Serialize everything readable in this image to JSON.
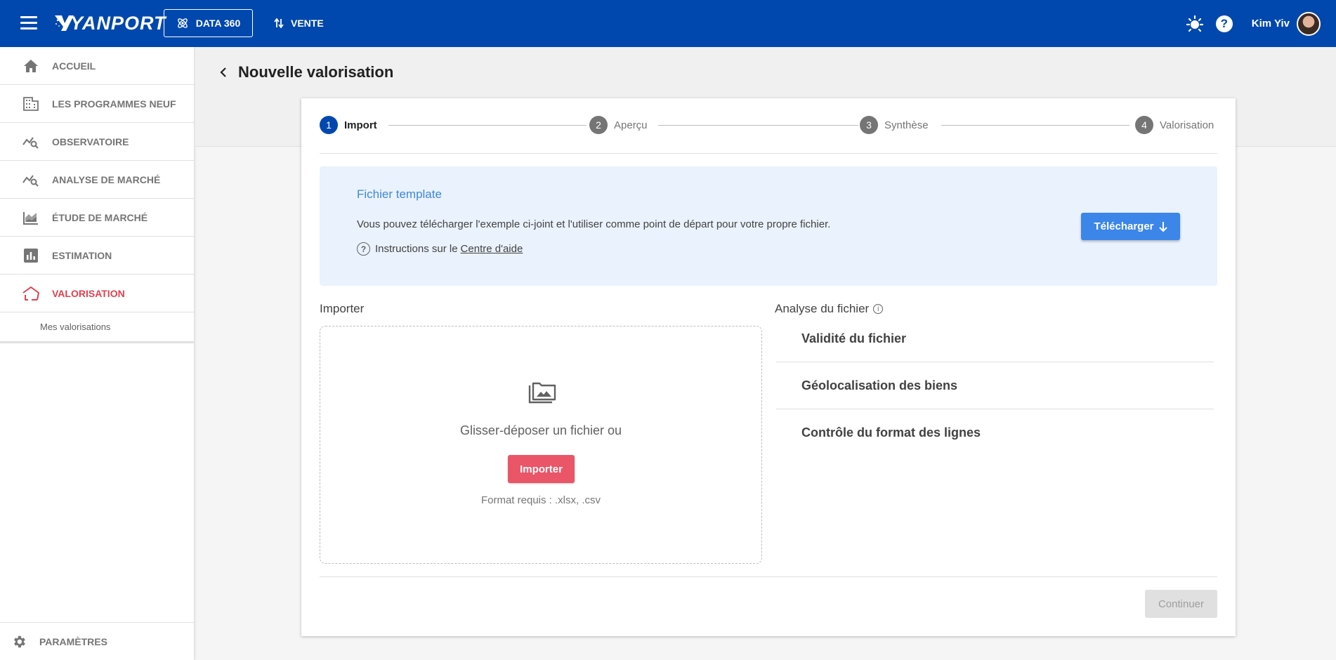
{
  "topbar": {
    "logo_text": "YANPORT",
    "data360_label": "DATA 360",
    "vente_label": "VENTE",
    "username": "Kim Yiv",
    "help_label": "?"
  },
  "sidebar": {
    "items": [
      {
        "label": "ACCUEIL",
        "icon": "home-icon"
      },
      {
        "label": "LES PROGRAMMES NEUF",
        "icon": "building-icon"
      },
      {
        "label": "OBSERVATOIRE",
        "icon": "chart-search-icon"
      },
      {
        "label": "ANALYSE DE MARCHÉ",
        "icon": "chart-search-icon"
      },
      {
        "label": "ÉTUDE DE MARCHÉ",
        "icon": "area-chart-icon"
      },
      {
        "label": "ESTIMATION",
        "icon": "bar-chart-icon"
      },
      {
        "label": "VALORISATION",
        "icon": "house-outline-icon",
        "active": true
      }
    ],
    "sub_item": "Mes valorisations",
    "params_label": "PARAMÈTRES"
  },
  "page": {
    "title": "Nouvelle valorisation"
  },
  "stepper": {
    "steps": [
      {
        "num": "1",
        "label": "Import",
        "active": true
      },
      {
        "num": "2",
        "label": "Aperçu"
      },
      {
        "num": "3",
        "label": "Synthèse"
      },
      {
        "num": "4",
        "label": "Valorisation"
      }
    ]
  },
  "template": {
    "title": "Fichier template",
    "text": "Vous pouvez télécharger l'exemple ci-joint et l'utiliser comme point de départ pour votre propre fichier.",
    "help_prefix": "Instructions sur le",
    "help_link": "Centre d'aide",
    "download_label": "Télécharger"
  },
  "importer": {
    "title": "Importer",
    "drop_text": "Glisser-déposer un fichier ou",
    "button_label": "Importer",
    "format_text": "Format requis : .xlsx, .csv"
  },
  "analyse": {
    "title": "Analyse du fichier",
    "items": [
      "Validité du fichier",
      "Géolocalisation des biens",
      "Contrôle du format des lignes"
    ]
  },
  "footer": {
    "continue_label": "Continuer"
  },
  "colors": {
    "topbar": "#0048ad",
    "active_nav": "#e0404f",
    "download_button": "#3b86e8",
    "import_button": "#ea5568"
  }
}
